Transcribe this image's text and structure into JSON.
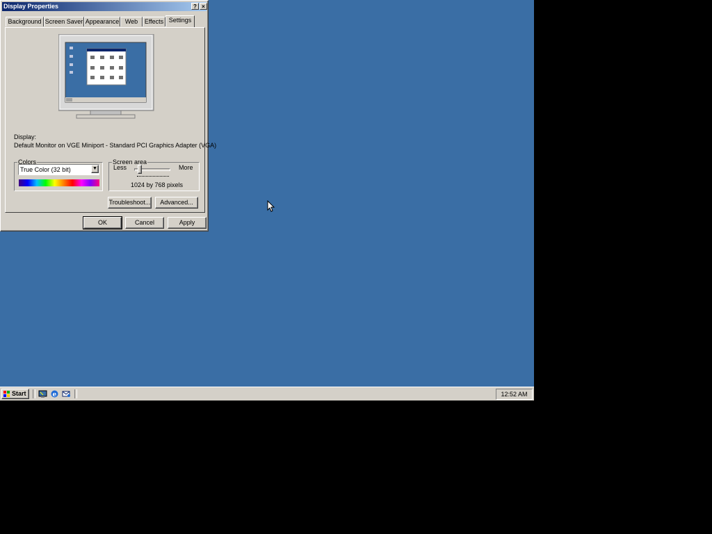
{
  "dialog": {
    "title": "Display Properties",
    "help_glyph": "?",
    "close_glyph": "×",
    "tabs": [
      {
        "label": "Background"
      },
      {
        "label": "Screen Saver"
      },
      {
        "label": "Appearance"
      },
      {
        "label": "Web"
      },
      {
        "label": "Effects"
      },
      {
        "label": "Settings"
      }
    ],
    "active_tab": "Settings",
    "display_label": "Display:",
    "display_value": "Default Monitor on VGE Miniport - Standard PCI Graphics Adapter (VGA)",
    "colors": {
      "legend": "Colors",
      "selected": "True Color (32 bit)"
    },
    "screen_area": {
      "legend": "Screen area",
      "less": "Less",
      "more": "More",
      "value": "1024 by 768 pixels",
      "level": 0.15
    },
    "troubleshoot_label": "Troubleshoot...",
    "advanced_label": "Advanced...",
    "ok_label": "OK",
    "cancel_label": "Cancel",
    "apply_label": "Apply"
  },
  "taskbar": {
    "start_label": "Start",
    "quick_launch": [
      "show-desktop-icon",
      "internet-explorer-icon",
      "outlook-express-icon"
    ],
    "clock": "12:52 AM"
  },
  "colors": {
    "desktop": "#3a6ea5",
    "title_start": "#0a246a",
    "title_end": "#a6caf0",
    "face": "#d4d0c8"
  }
}
